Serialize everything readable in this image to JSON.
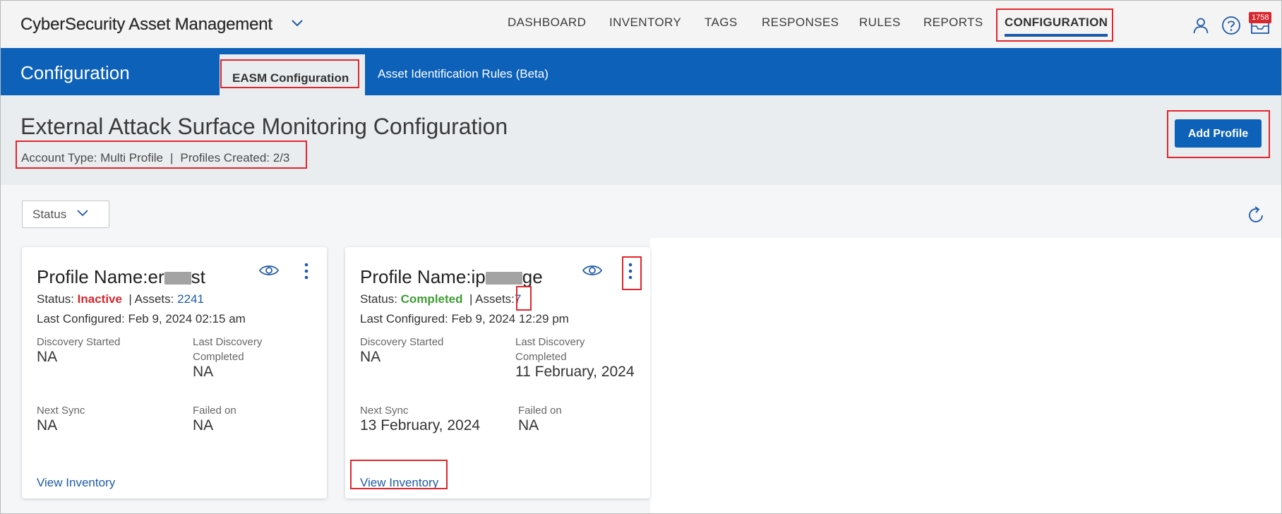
{
  "app": {
    "title": "CyberSecurity Asset Management"
  },
  "nav": {
    "items": [
      {
        "label": "DASHBOARD"
      },
      {
        "label": "INVENTORY"
      },
      {
        "label": "TAGS"
      },
      {
        "label": "RESPONSES"
      },
      {
        "label": "RULES"
      },
      {
        "label": "REPORTS"
      },
      {
        "label": "CONFIGURATION",
        "active": true
      }
    ],
    "notification_count": "1758"
  },
  "band": {
    "title": "Configuration",
    "tabs": [
      {
        "label": "EASM Configuration",
        "active": true
      },
      {
        "label": "Asset Identification Rules (Beta)"
      }
    ]
  },
  "header": {
    "title": "External Attack Surface Monitoring Configuration",
    "account_type_label": "Account Type:",
    "account_type_value": "Multi Profile",
    "profiles_created_label": "Profiles Created:",
    "profiles_created_value": "2/3",
    "add_profile_label": "Add Profile"
  },
  "filters": {
    "status_label": "Status"
  },
  "cards": [
    {
      "name_label": "Profile Name:",
      "name_prefix": "er",
      "name_suffix": "st",
      "status_label": "Status:",
      "status_value": "Inactive",
      "assets_label": "| Assets:",
      "assets_value": "2241",
      "last_configured": "Last Configured: Feb 9, 2024 02:15 am",
      "discovery_started_label": "Discovery Started",
      "discovery_started_value": "NA",
      "last_discovery_label": "Last Discovery Completed",
      "last_discovery_value": "NA",
      "next_sync_label": "Next Sync",
      "next_sync_value": "NA",
      "failed_on_label": "Failed on",
      "failed_on_value": "NA",
      "view_inventory_label": "View Inventory"
    },
    {
      "name_label": "Profile Name:",
      "name_prefix": "ip",
      "name_suffix": "ge",
      "status_label": "Status:",
      "status_value": "Completed",
      "assets_label": "| Assets:",
      "assets_value": "7",
      "last_configured": "Last Configured: Feb 9, 2024 12:29 pm",
      "discovery_started_label": "Discovery Started",
      "discovery_started_value": "NA",
      "last_discovery_label": "Last Discovery Completed",
      "last_discovery_value": "11 February, 2024",
      "next_sync_label": "Next Sync",
      "next_sync_value": "13 February, 2024",
      "failed_on_label": "Failed on",
      "failed_on_value": "NA",
      "view_inventory_label": "View Inventory"
    }
  ],
  "colors": {
    "brand_blue": "#0d61b9",
    "link_blue": "#1e5aa6",
    "inactive_red": "#d6282e",
    "completed_green": "#3f9c35",
    "highlight_red": "#e2262d"
  }
}
